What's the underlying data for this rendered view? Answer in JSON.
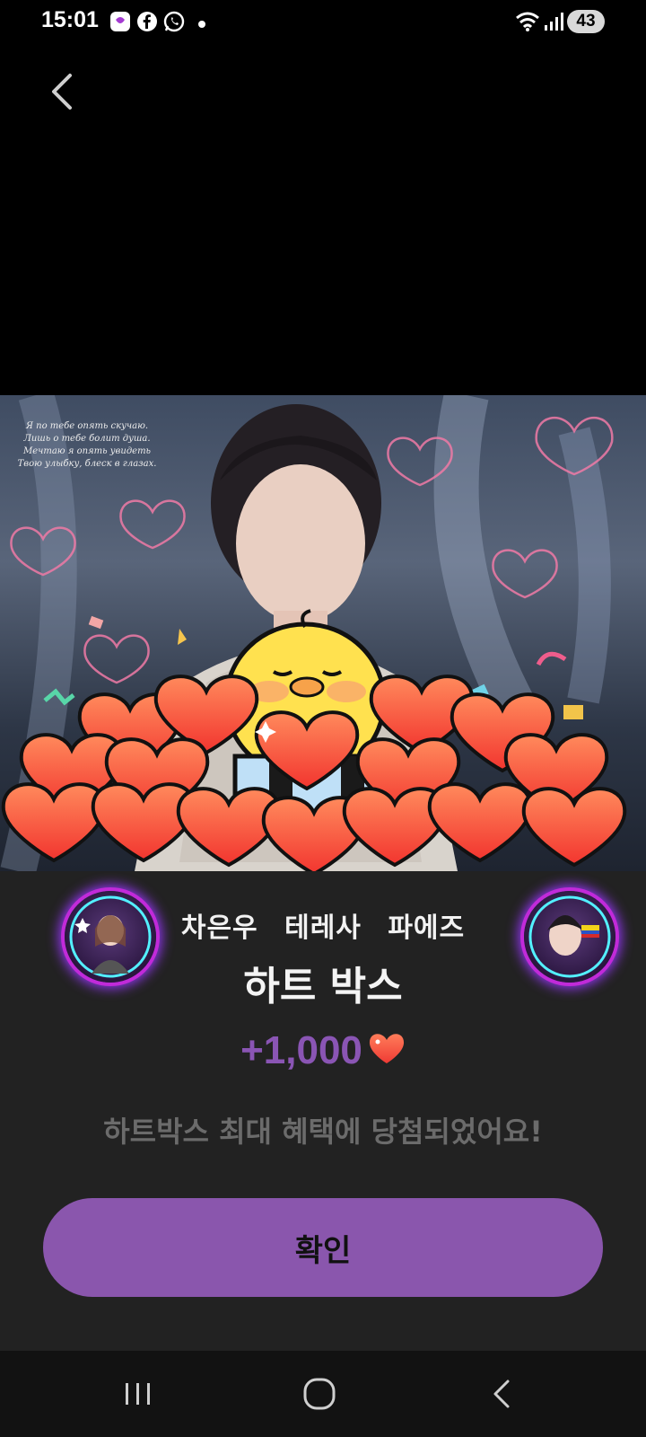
{
  "status_bar": {
    "time": "15:01",
    "battery": "43",
    "notifications": [
      "app-badge-icon",
      "facebook-icon",
      "whatsapp-icon",
      "dot-icon"
    ]
  },
  "hero": {
    "poem_lines": [
      "Я по тебе опять скучаю.",
      "Лишь о тебе болит душа.",
      "Мечтаю я опять увидеть",
      "Твою улыбку, блеск в глазах."
    ]
  },
  "dialog": {
    "names": "차은우 테레사 파에즈",
    "title": "하트 박스",
    "reward": "+1,000",
    "message": "하트박스 최대 혜택에 당첨되었어요!",
    "confirm_label": "확인"
  },
  "colors": {
    "accent": "#8a56ad",
    "reward": "#8a55b4",
    "heart": "#f24a3a",
    "background": "#222222"
  }
}
